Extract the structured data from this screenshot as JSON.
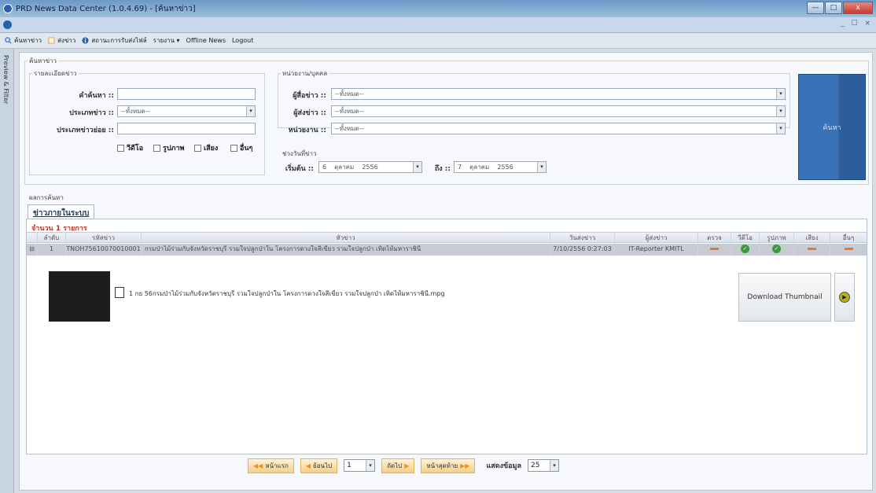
{
  "window": {
    "title": "PRD News Data Center (1.0.4.69) - [ค้นหาข่าว]",
    "buttons": {
      "minimize": "—",
      "maximize": "□",
      "close": "x"
    }
  },
  "mdi_controls": "_ ☐ ×",
  "menu": [
    {
      "label": "ค้นหาข่าว",
      "icon": "search-icon",
      "color": "#3a7bd5"
    },
    {
      "label": "ส่งข่าว",
      "icon": "document-icon",
      "color": "#e6a23c"
    },
    {
      "label": "สถานะการรับส่งไฟล์",
      "icon": "info-icon",
      "color": "#2b5fa9"
    },
    {
      "label": "รายงาน ▾",
      "icon": "",
      "color": ""
    },
    {
      "label": "Offline News",
      "icon": "",
      "color": ""
    },
    {
      "label": "Logout",
      "icon": "",
      "color": ""
    }
  ],
  "side_tab": "Preview & Filter",
  "search": {
    "group_title": "ค้นหาข่าว",
    "details_title": "รายละเอียดข่าว",
    "keyword_label": "คำค้นหา ::",
    "keyword_value": "",
    "type_label": "ประเภทข่าว ::",
    "type_value": "--ทั้งหมด--",
    "subtype_label": "ประเภทข่าวย่อย ::",
    "subtype_value": "",
    "media": [
      "วีดีโอ",
      "รูปภาพ",
      "เสียง",
      "อื่นๆ"
    ],
    "org_title": "หน่วยงาน/บุคคล",
    "reporter_label": "ผู้สื่อข่าว ::",
    "reporter_value": "--ทั้งหมด--",
    "sender_label": "ผู้ส่งข่าว ::",
    "sender_value": "--ทั้งหมด--",
    "agency_label": "หน่วยงาน ::",
    "agency_value": "--ทั้งหมด--",
    "date_title": "ช่วงวันที่ข่าว",
    "start_label": "เริ่มต้น ::",
    "start_date": {
      "day": "6",
      "month": "ตุลาคม",
      "year": "2556"
    },
    "end_label": "ถึง ::",
    "end_date": {
      "day": "7",
      "month": "ตุลาคม",
      "year": "2556"
    },
    "button_label": "ค้นหา"
  },
  "results": {
    "group_title": "ผลการค้นหา",
    "tab_label": "ข่าวภายในระบบ",
    "count_text": "จำนวน 1 รายการ",
    "columns": [
      "ลำดับ",
      "รหัสข่าว",
      "หัวข่าว",
      "วันส่งข่าว",
      "ผู้ส่งข่าว",
      "ตรวจ",
      "วีดีโอ",
      "รูปภาพ",
      "เสียง",
      "อื่นๆ"
    ],
    "rows": [
      {
        "index": "1",
        "id": "TNOH75610070010001",
        "headline": "กรมป่าไม้ร่วมกับจังหวัดราชบุรี รวมใจปลูกป่าใน โครงการดวงใจสีเขียว รวมใจปลูกป่า เทิดไท้มหาราชินี",
        "date": "7/10/2556 0:27:03",
        "sender": "IT-Reporter KMITL",
        "status": [
          "dash",
          "ok",
          "ok",
          "dash",
          "dash"
        ]
      }
    ],
    "detail": {
      "file_name": "1 กย 56กรมป่าไม้ร่วมกับจังหวัดราชบุรี รวมใจปลูกป่าใน โครงการดวงใจสีเขียว รวมใจปลูกป่า เทิดไท้มหาราชินี.mpg",
      "download_label": "Download Thumbnail"
    }
  },
  "pager": {
    "first_label": "หน้าแรก",
    "prev_label": "ย้อนไป",
    "page_value": "1",
    "next_label": "ถัดไป",
    "last_label": "หน้าสุดท้าย",
    "show_label": "แสดงข้อมูล",
    "show_value": "25"
  }
}
